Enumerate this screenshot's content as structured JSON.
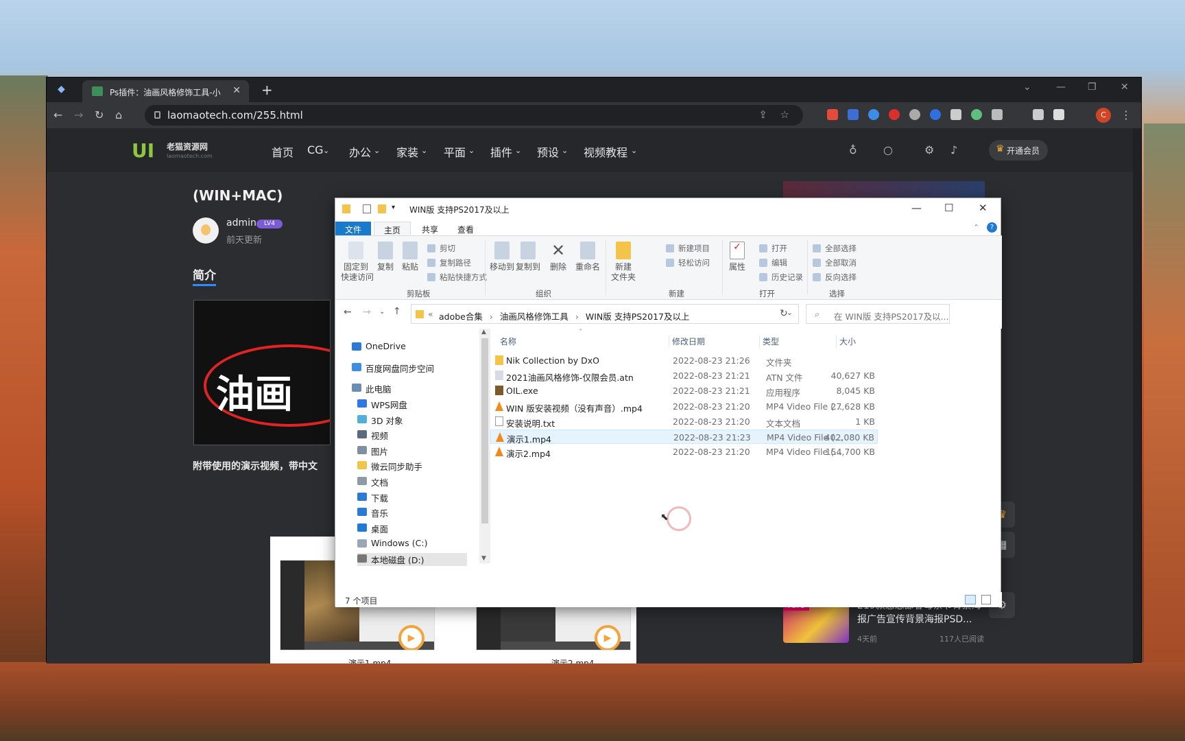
{
  "browser": {
    "tab_title": "Ps插件：油画风格修饰工具-小",
    "url": "laomaotech.com/255.html",
    "profile_initial": "C"
  },
  "site": {
    "logo_mark": "UI",
    "logo_name": "老猫资源网",
    "logo_sub": "laomaotech.com",
    "menu": [
      "首页",
      "CG",
      "办公",
      "家装",
      "平面",
      "插件",
      "预设",
      "视频教程"
    ],
    "vip_label": "开通会员"
  },
  "article": {
    "title": "(WIN+MAC)",
    "author": "admin",
    "level": "LV4",
    "updated": "前天更新",
    "section": "简介",
    "banner_text": "油画",
    "paragraph": "附带使用的演示视频，带中文"
  },
  "videos": [
    {
      "name": "演示1.mp4"
    },
    {
      "name": "演示2.mp4"
    }
  ],
  "sidebar_hot": {
    "badge": "TOP3",
    "title": "219款感恩節春母亲节背景海报广告宣传背景海报PSD...",
    "time": "4天前",
    "reads": "117人已阅读"
  },
  "explorer": {
    "title": "WIN版 支持PS2017及以上",
    "ribbon_tabs": [
      "文件",
      "主页",
      "共享",
      "查看"
    ],
    "ribbon": {
      "pin": "固定到\n快速访问",
      "copy": "复制",
      "paste": "粘贴",
      "cut": "剪切",
      "copy_path": "复制路径",
      "paste_shortcut": "粘贴快捷方式",
      "group_clipboard": "剪贴板",
      "move_to": "移动到",
      "copy_to": "复制到",
      "delete": "删除",
      "rename": "重命名",
      "group_organize": "组织",
      "new_folder": "新建\n文件夹",
      "new_item": "新建项目",
      "easy_access": "轻松访问",
      "group_new": "新建",
      "properties": "属性",
      "open": "打开",
      "edit": "编辑",
      "history": "历史记录",
      "group_open": "打开",
      "select_all": "全部选择",
      "select_none": "全部取消",
      "invert": "反向选择",
      "group_select": "选择"
    },
    "breadcrumb": [
      "adobe合集",
      "油画风格修饰工具",
      "WIN版 支持PS2017及以上"
    ],
    "search_placeholder": "在 WIN版 支持PS2017及以...",
    "nav": [
      "OneDrive",
      "百度网盘同步空间",
      "此电脑",
      "WPS网盘",
      "3D 对象",
      "视频",
      "图片",
      "微云同步助手",
      "文档",
      "下载",
      "音乐",
      "桌面",
      "Windows (C:)",
      "本地磁盘 (D:)"
    ],
    "columns": [
      "名称",
      "修改日期",
      "类型",
      "大小"
    ],
    "files": [
      {
        "name": "Nik Collection by DxO",
        "date": "2022-08-23 21:26",
        "type": "文件夹",
        "size": ""
      },
      {
        "name": "2021油画风格修饰-仅限会员.atn",
        "date": "2022-08-23 21:21",
        "type": "ATN 文件",
        "size": "40,627 KB"
      },
      {
        "name": "OIL.exe",
        "date": "2022-08-23 21:21",
        "type": "应用程序",
        "size": "8,045 KB"
      },
      {
        "name": "WIN 版安装视频（没有声音）.mp4",
        "date": "2022-08-23 21:20",
        "type": "MP4 Video File (...",
        "size": "27,628 KB"
      },
      {
        "name": "安装说明.txt",
        "date": "2022-08-23 21:20",
        "type": "文本文档",
        "size": "1 KB"
      },
      {
        "name": "演示1.mp4",
        "date": "2022-08-23 21:23",
        "type": "MP4 Video File (...",
        "size": "402,080 KB"
      },
      {
        "name": "演示2.mp4",
        "date": "2022-08-23 21:20",
        "type": "MP4 Video File (...",
        "size": "154,700 KB"
      }
    ],
    "status": "7 个项目"
  }
}
